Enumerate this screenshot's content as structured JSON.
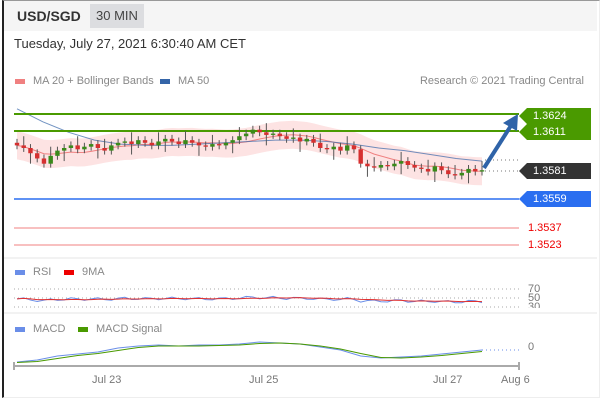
{
  "header": {
    "pair": "USD/SGD",
    "timeframe": "30 MIN"
  },
  "timestamp": "Tuesday, July 27, 2021 6:30:40 AM CET",
  "legend": {
    "ma20": "MA 20 + Bollinger Bands",
    "ma50": "MA 50",
    "credit": "Research © 2021 Trading Central"
  },
  "levels": {
    "r2": "1.3624",
    "r1": "1.3611",
    "last": "1.3581",
    "pivot": "1.3559",
    "s1": "1.3537",
    "s2": "1.3523"
  },
  "rsi": {
    "label": "RSI",
    "ma_label": "9MA",
    "ticks": [
      "70",
      "50",
      "30"
    ]
  },
  "macd": {
    "label": "MACD",
    "signal_label": "MACD Signal",
    "zero": "0"
  },
  "xaxis": [
    "Jul 23",
    "Jul 25",
    "Jul 27",
    "Aug 6"
  ],
  "colors": {
    "resistance": "#4a9a00",
    "pivot": "#2a6ef0",
    "support": "#f08080",
    "last": "#333333",
    "ma20": "#f08080",
    "ma50": "#3565a8"
  },
  "chart_data": {
    "type": "candlestick",
    "symbol": "USD/SGD",
    "interval": "30 MIN",
    "closes": [
      1.36,
      1.3598,
      1.3594,
      1.359,
      1.3586,
      1.3592,
      1.3596,
      1.3598,
      1.36,
      1.3597,
      1.3599,
      1.3601,
      1.3598,
      1.3596,
      1.36,
      1.3602,
      1.3603,
      1.3601,
      1.3604,
      1.3602,
      1.36,
      1.3603,
      1.3605,
      1.3603,
      1.3601,
      1.3604,
      1.3602,
      1.36,
      1.3599,
      1.3601,
      1.36,
      1.3602,
      1.3604,
      1.3607,
      1.3609,
      1.3612,
      1.361,
      1.3608,
      1.3609,
      1.3607,
      1.3605,
      1.3606,
      1.3603,
      1.3605,
      1.3602,
      1.3598,
      1.3597,
      1.3599,
      1.3596,
      1.36,
      1.3597,
      1.3586,
      1.3584,
      1.3583,
      1.3585,
      1.3584,
      1.3586,
      1.3588,
      1.3585,
      1.3583,
      1.3582,
      1.358,
      1.3584,
      1.3581,
      1.3578,
      1.3577,
      1.3579,
      1.3582,
      1.358,
      1.3581
    ],
    "ma50": [
      1.3628,
      1.3618,
      1.361,
      1.3604,
      1.3601,
      1.36,
      1.36,
      1.3601,
      1.3602,
      1.3603,
      1.3604,
      1.3604,
      1.3603,
      1.3601,
      1.3598,
      1.3596,
      1.3593,
      1.359,
      1.3588
    ],
    "rsi_range": [
      30,
      70
    ],
    "macd_zero": 0
  }
}
